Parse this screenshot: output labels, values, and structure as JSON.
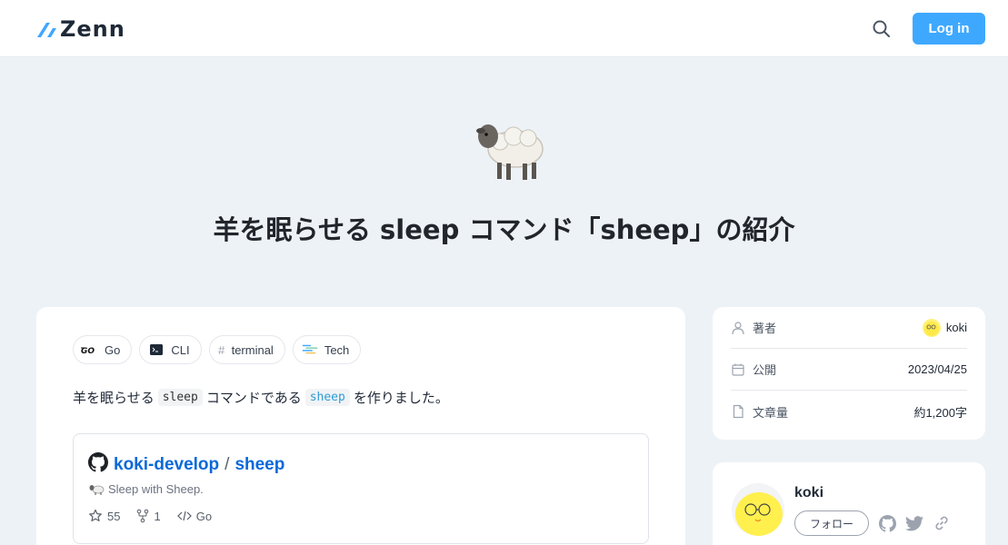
{
  "header": {
    "logo_text": "Zenn",
    "login_label": "Log in"
  },
  "hero": {
    "emoji": "sheep",
    "title": "羊を眠らせる sleep コマンド「sheep」の紹介"
  },
  "article": {
    "topics": [
      {
        "label": "Go",
        "icon": "go-logo-icon"
      },
      {
        "label": "CLI",
        "icon": "terminal-window-icon"
      },
      {
        "label": "terminal",
        "icon": "hash-icon"
      },
      {
        "label": "Tech",
        "icon": "tech-icon"
      }
    ],
    "intro": {
      "part1": "羊を眠らせる",
      "code1": "sleep",
      "part2": "コマンドである",
      "code2": "sheep",
      "part3": "を作りました。"
    },
    "github_card": {
      "owner": "koki-develop",
      "slash": "/",
      "repo": "sheep",
      "description": "Sleep with Sheep.",
      "stars": "55",
      "forks": "1",
      "language": "Go"
    }
  },
  "info": {
    "author_label": "著者",
    "author_value": "koki",
    "published_label": "公開",
    "published_value": "2023/04/25",
    "length_label": "文章量",
    "length_value": "約1,200字"
  },
  "author_card": {
    "name": "koki",
    "follow_label": "フォロー"
  },
  "colors": {
    "brand": "#3ea8ff",
    "background": "#edf2f7",
    "link": "#0969da"
  }
}
